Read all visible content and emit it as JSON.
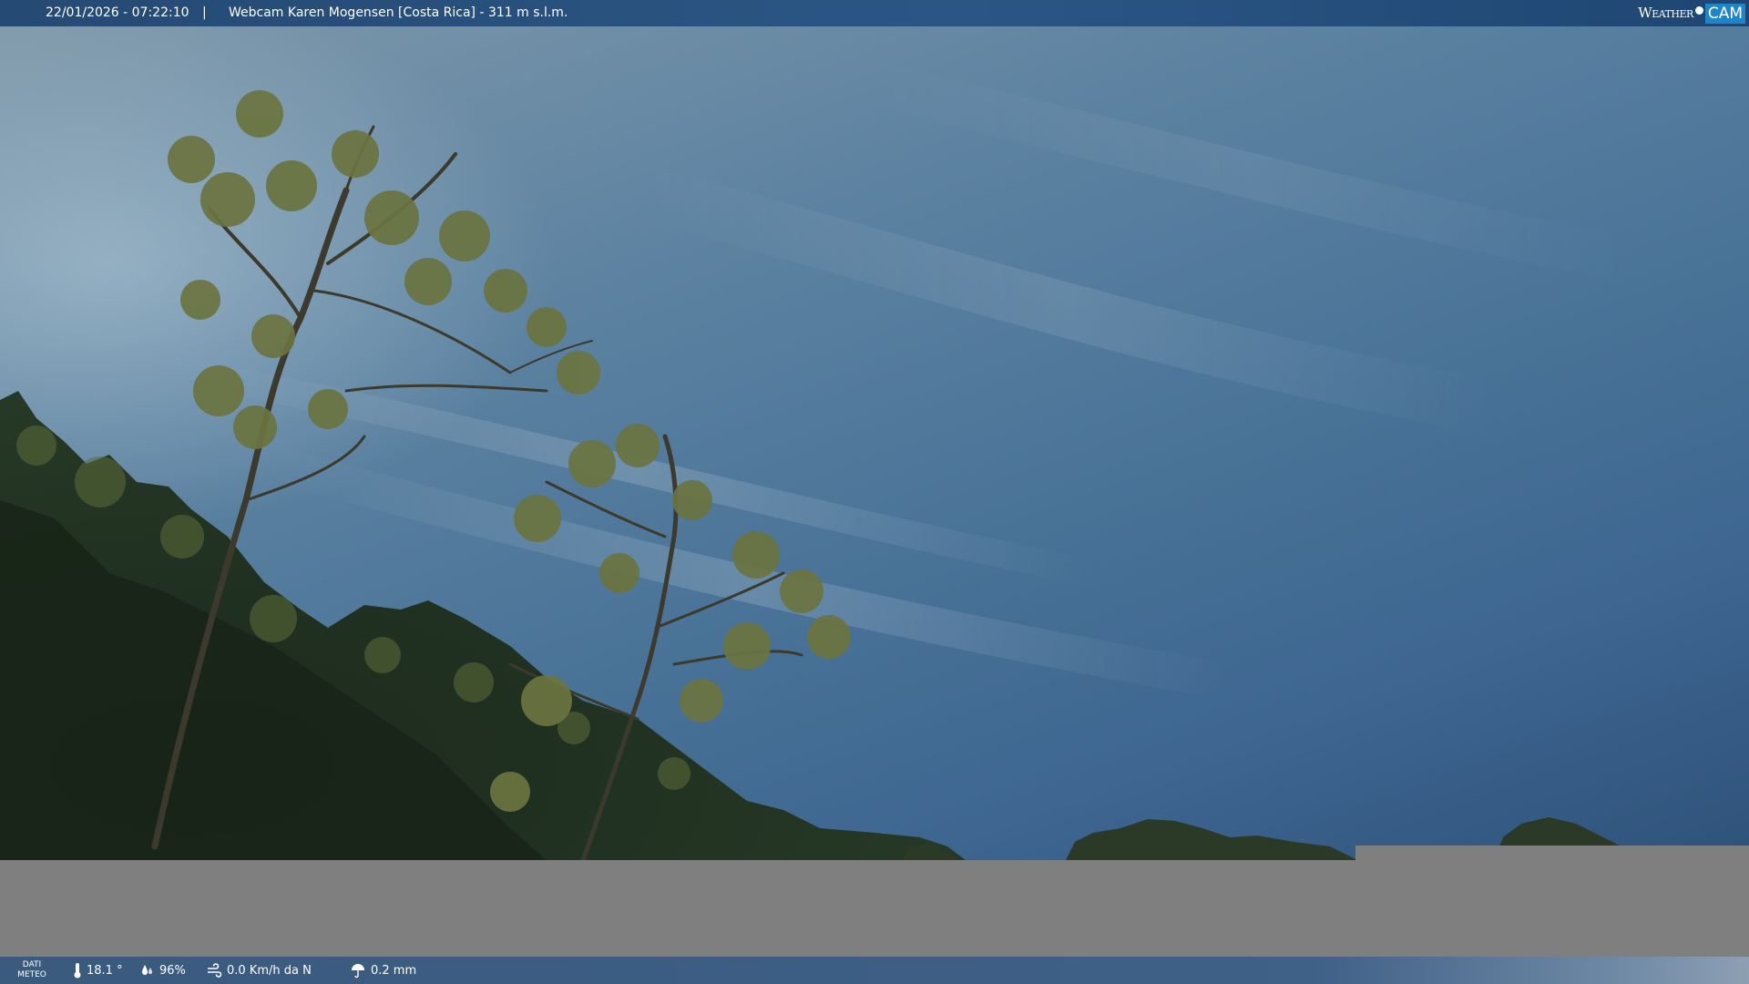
{
  "header": {
    "datetime": "22/01/2026 - 07:22:10",
    "separator": "|",
    "title": "Webcam Karen Mogensen [Costa Rica]  - 311 m s.l.m."
  },
  "logo": {
    "word": "Weather",
    "cam": "CAM"
  },
  "weather": {
    "dati_line1": "DATI",
    "dati_line2": "METEO",
    "temperature": "18.1 °",
    "temperature_icon": "thermometer-icon",
    "humidity": "96%",
    "humidity_icon": "humidity-drops-icon",
    "wind": "0.0 Km/h da N",
    "wind_icon": "wind-icon",
    "rain": "0.2 mm",
    "rain_icon": "rain-umbrella-icon"
  },
  "colors": {
    "top_bar": "#2b5684",
    "bottom_bar": "#3f6087",
    "logo_cam_bg": "#1c86c8",
    "no_signal_gray": "#7f7f7f"
  }
}
